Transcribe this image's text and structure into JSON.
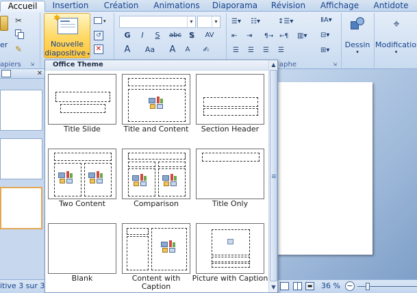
{
  "tabs": [
    {
      "label": "Accueil",
      "active": true
    },
    {
      "label": "Insertion"
    },
    {
      "label": "Création"
    },
    {
      "label": "Animations"
    },
    {
      "label": "Diaporama"
    },
    {
      "label": "Révision"
    },
    {
      "label": "Affichage"
    },
    {
      "label": "Antidote"
    }
  ],
  "ribbon": {
    "clipboard_partial_label": "er",
    "clipboard_group": "apiers",
    "new_slide_label_1": "Nouvelle",
    "new_slide_label_2": "diapositive",
    "paragraph_group": "aphe",
    "font_buttons": [
      "G",
      "I",
      "S",
      "abc",
      "S",
      "AV"
    ],
    "font_size_buttons": [
      "A",
      "Aa",
      "A",
      "A"
    ],
    "dessin_label": "Dessin",
    "modification_label": "Modification"
  },
  "gallery": {
    "header": "Office Theme",
    "layouts": [
      {
        "name": "Title Slide"
      },
      {
        "name": "Title and Content"
      },
      {
        "name": "Section Header"
      },
      {
        "name": "Two Content"
      },
      {
        "name": "Comparison"
      },
      {
        "name": "Title Only"
      },
      {
        "name": "Blank"
      },
      {
        "name": "Content with Caption"
      },
      {
        "name": "Picture with Caption"
      }
    ]
  },
  "status": {
    "slide_info": "itive 3 sur 3",
    "zoom": "36 %"
  },
  "icons": {
    "scroll_up": "scroll-up-arrow-icon",
    "scroll_down": "scroll-down-arrow-icon",
    "content_placeholder": "content-insert-icon"
  }
}
